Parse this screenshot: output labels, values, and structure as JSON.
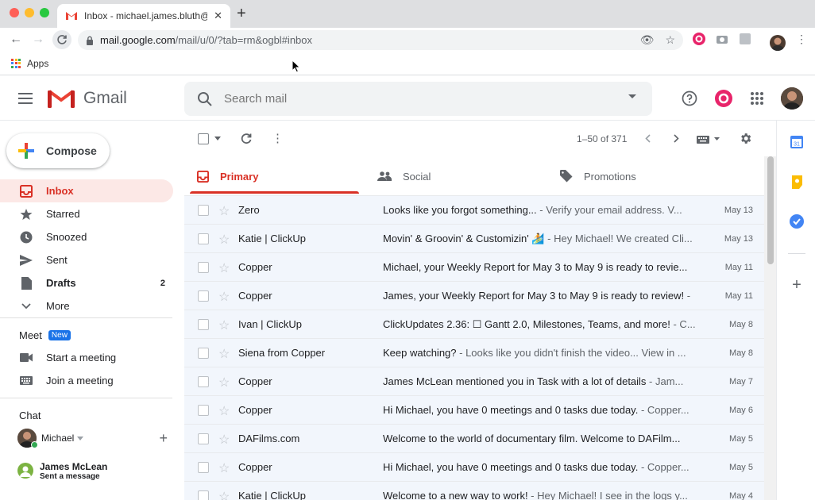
{
  "browser": {
    "tab_title": "Inbox - michael.james.bluth@g",
    "url_host": "mail.google.com",
    "url_path": "/mail/u/0/?tab=rm&ogbl#inbox",
    "bookmarks_apps": "Apps"
  },
  "header": {
    "logo_text": "Gmail",
    "search_placeholder": "Search mail"
  },
  "sidebar": {
    "compose_label": "Compose",
    "items": [
      {
        "label": "Inbox",
        "count": "",
        "active": true
      },
      {
        "label": "Starred",
        "count": ""
      },
      {
        "label": "Snoozed",
        "count": ""
      },
      {
        "label": "Sent",
        "count": ""
      },
      {
        "label": "Drafts",
        "count": "2"
      },
      {
        "label": "More",
        "count": ""
      }
    ],
    "meet": {
      "title": "Meet",
      "badge": "New",
      "start": "Start a meeting",
      "join": "Join a meeting"
    },
    "chat": {
      "title": "Chat",
      "user": "Michael",
      "contact_name": "James McLean",
      "contact_status": "Sent a message"
    }
  },
  "toolbar": {
    "pagination": "1–50 of 371"
  },
  "tabs": [
    {
      "label": "Primary",
      "active": true
    },
    {
      "label": "Social"
    },
    {
      "label": "Promotions"
    }
  ],
  "emails": [
    {
      "sender": "Zero",
      "subject": "Looks like you forgot something...",
      "preview": " - Verify your email address. V...",
      "date": "May 13"
    },
    {
      "sender": "Katie | ClickUp",
      "subject": "Movin' & Groovin' & Customizin' 🏄",
      "preview": " - Hey Michael! We created Cli...",
      "date": "May 13"
    },
    {
      "sender": "Copper",
      "subject": "Michael, your Weekly Report for May 3 to May 9 is ready to revie...",
      "preview": "",
      "date": "May 11"
    },
    {
      "sender": "Copper",
      "subject": "James, your Weekly Report for May 3 to May 9 is ready to review!",
      "preview": " -",
      "date": "May 11"
    },
    {
      "sender": "Ivan | ClickUp",
      "subject": "ClickUpdates 2.36: ☐ Gantt 2.0, Milestones, Teams, and more!",
      "preview": " - C...",
      "date": "May 8"
    },
    {
      "sender": "Siena from Copper",
      "subject": "Keep watching?",
      "preview": " - Looks like you didn't finish the video... View in ...",
      "date": "May 8"
    },
    {
      "sender": "Copper",
      "subject": "James McLean mentioned you in Task with a lot of details",
      "preview": " - Jam...",
      "date": "May 7"
    },
    {
      "sender": "Copper",
      "subject": "Hi Michael, you have 0 meetings and 0 tasks due today.",
      "preview": " - Copper...",
      "date": "May 6"
    },
    {
      "sender": "DAFilms.com",
      "subject": "Welcome to the world of documentary film. Welcome to DAFilm...",
      "preview": "",
      "date": "May 5"
    },
    {
      "sender": "Copper",
      "subject": "Hi Michael, you have 0 meetings and 0 tasks due today.",
      "preview": " - Copper...",
      "date": "May 5"
    },
    {
      "sender": "Katie | ClickUp",
      "subject": "Welcome to a new way to work!",
      "preview": " - Hey Michael! I see in the logs y...",
      "date": "May 4"
    }
  ],
  "colors": {
    "accent": "#d93025",
    "unread_bg": "#f2f6fc",
    "badge": "#1a73e8"
  }
}
